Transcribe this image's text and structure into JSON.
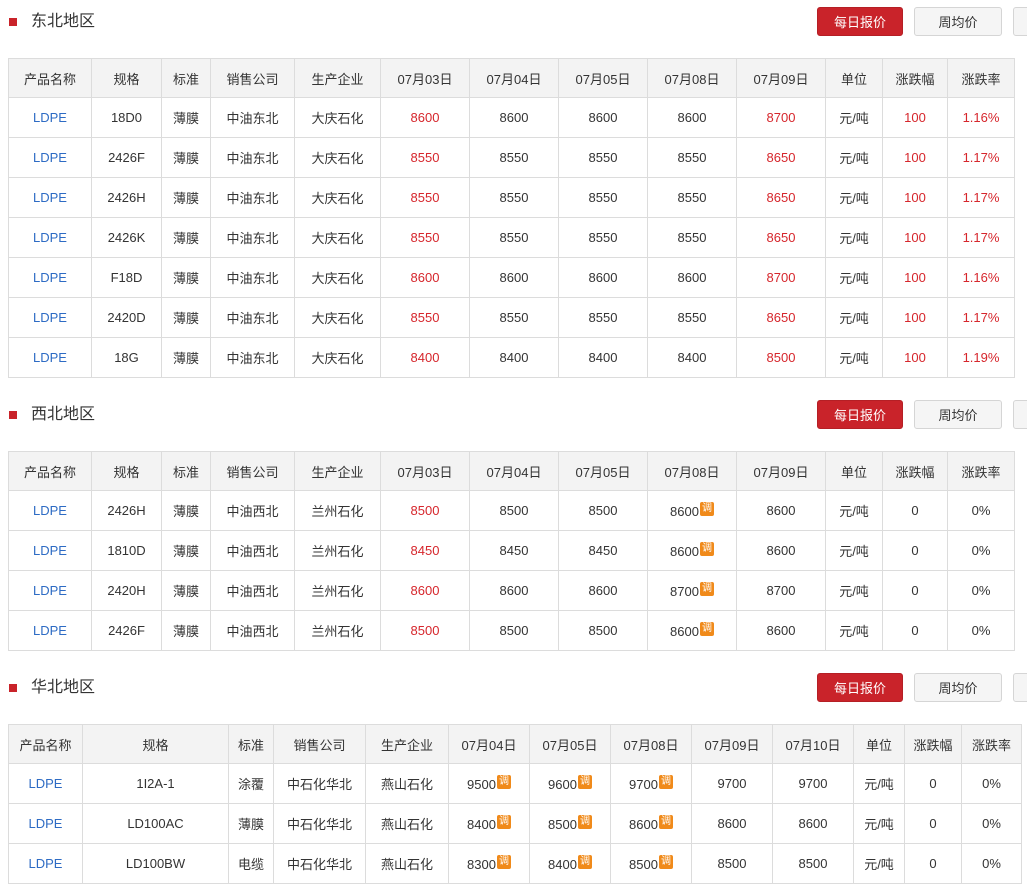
{
  "buttons": {
    "daily": "每日报价",
    "weekly": "周均价"
  },
  "adjust_badge": "调",
  "colors": {
    "accent": "#c9232a",
    "link": "#2d6bc4",
    "up": "#d6262c",
    "adjust": "#f08a1a"
  },
  "sections": [
    {
      "title": "东北地区",
      "headers": [
        "产品名称",
        "规格",
        "标准",
        "销售公司",
        "生产企业",
        "07月03日",
        "07月04日",
        "07月05日",
        "07月08日",
        "07月09日",
        "单位",
        "涨跌幅",
        "涨跌率"
      ],
      "rows": [
        {
          "cells": [
            "LDPE",
            "18D0",
            "薄膜",
            "中油东北",
            "大庆石化",
            "8600",
            "8600",
            "8600",
            "8600",
            "8700",
            "元/吨",
            "100",
            "1.16%"
          ]
        },
        {
          "cells": [
            "LDPE",
            "2426F",
            "薄膜",
            "中油东北",
            "大庆石化",
            "8550",
            "8550",
            "8550",
            "8550",
            "8650",
            "元/吨",
            "100",
            "1.17%"
          ]
        },
        {
          "cells": [
            "LDPE",
            "2426H",
            "薄膜",
            "中油东北",
            "大庆石化",
            "8550",
            "8550",
            "8550",
            "8550",
            "8650",
            "元/吨",
            "100",
            "1.17%"
          ]
        },
        {
          "cells": [
            "LDPE",
            "2426K",
            "薄膜",
            "中油东北",
            "大庆石化",
            "8550",
            "8550",
            "8550",
            "8550",
            "8650",
            "元/吨",
            "100",
            "1.17%"
          ]
        },
        {
          "cells": [
            "LDPE",
            "F18D",
            "薄膜",
            "中油东北",
            "大庆石化",
            "8600",
            "8600",
            "8600",
            "8600",
            "8700",
            "元/吨",
            "100",
            "1.16%"
          ]
        },
        {
          "cells": [
            "LDPE",
            "2420D",
            "薄膜",
            "中油东北",
            "大庆石化",
            "8550",
            "8550",
            "8550",
            "8550",
            "8650",
            "元/吨",
            "100",
            "1.17%"
          ]
        },
        {
          "cells": [
            "LDPE",
            "18G",
            "薄膜",
            "中油东北",
            "大庆石化",
            "8400",
            "8400",
            "8400",
            "8400",
            "8500",
            "元/吨",
            "100",
            "1.19%"
          ]
        }
      ]
    },
    {
      "title": "西北地区",
      "headers": [
        "产品名称",
        "规格",
        "标准",
        "销售公司",
        "生产企业",
        "07月03日",
        "07月04日",
        "07月05日",
        "07月08日",
        "07月09日",
        "单位",
        "涨跌幅",
        "涨跌率"
      ],
      "rows": [
        {
          "cells": [
            "LDPE",
            "2426H",
            "薄膜",
            "中油西北",
            "兰州石化",
            "8500",
            "8500",
            "8500",
            "8600",
            "8600",
            "元/吨",
            "0",
            "0%"
          ]
        },
        {
          "cells": [
            "LDPE",
            "1810D",
            "薄膜",
            "中油西北",
            "兰州石化",
            "8450",
            "8450",
            "8450",
            "8600",
            "8600",
            "元/吨",
            "0",
            "0%"
          ]
        },
        {
          "cells": [
            "LDPE",
            "2420H",
            "薄膜",
            "中油西北",
            "兰州石化",
            "8600",
            "8600",
            "8600",
            "8700",
            "8700",
            "元/吨",
            "0",
            "0%"
          ]
        },
        {
          "cells": [
            "LDPE",
            "2426F",
            "薄膜",
            "中油西北",
            "兰州石化",
            "8500",
            "8500",
            "8500",
            "8600",
            "8600",
            "元/吨",
            "0",
            "0%"
          ]
        }
      ]
    },
    {
      "title": "华北地区",
      "headers": [
        "产品名称",
        "规格",
        "标准",
        "销售公司",
        "生产企业",
        "07月04日",
        "07月05日",
        "07月08日",
        "07月09日",
        "07月10日",
        "单位",
        "涨跌幅",
        "涨跌率"
      ],
      "rows": [
        {
          "cells": [
            "LDPE",
            "1I2A-1",
            "涂覆",
            "中石化华北",
            "燕山石化",
            "9500",
            "9600",
            "9700",
            "9700",
            "9700",
            "元/吨",
            "0",
            "0%"
          ]
        },
        {
          "cells": [
            "LDPE",
            "LD100AC",
            "薄膜",
            "中石化华北",
            "燕山石化",
            "8400",
            "8500",
            "8600",
            "8600",
            "8600",
            "元/吨",
            "0",
            "0%"
          ]
        },
        {
          "cells": [
            "LDPE",
            "LD100BW",
            "电缆",
            "中石化华北",
            "燕山石化",
            "8300",
            "8400",
            "8500",
            "8500",
            "8500",
            "元/吨",
            "0",
            "0%"
          ]
        }
      ]
    }
  ]
}
